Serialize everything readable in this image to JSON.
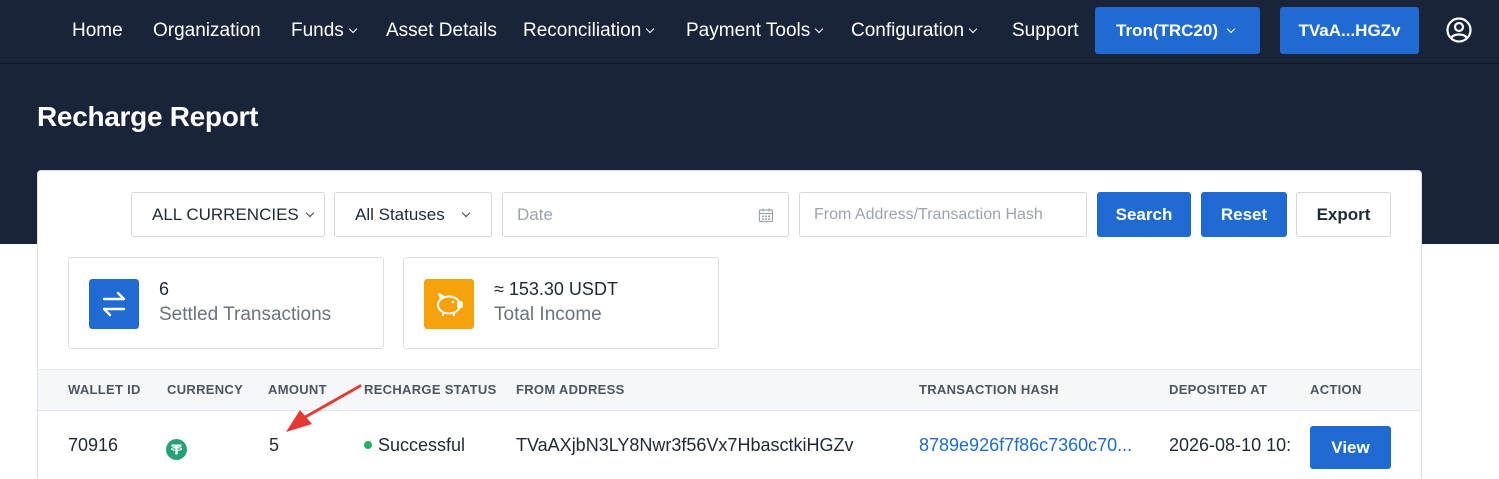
{
  "nav": {
    "items": [
      {
        "label": "Home",
        "dropdown": false
      },
      {
        "label": "Organization",
        "dropdown": false
      },
      {
        "label": "Funds",
        "dropdown": true
      },
      {
        "label": "Asset Details",
        "dropdown": false
      },
      {
        "label": "Reconciliation",
        "dropdown": true
      },
      {
        "label": "Payment Tools",
        "dropdown": true
      },
      {
        "label": "Configuration",
        "dropdown": true
      },
      {
        "label": "Support",
        "dropdown": false
      }
    ],
    "network_button": "Tron(TRC20)",
    "wallet_button": "TVaA...HGZv",
    "user_icon": "user-circle-icon"
  },
  "page": {
    "title": "Recharge Report"
  },
  "filters": {
    "currency_select": "ALL CURRENCIES",
    "status_select": "All Statuses",
    "date_placeholder": "Date",
    "search_placeholder": "From Address/Transaction Hash",
    "search_button": "Search",
    "reset_button": "Reset",
    "export_button": "Export"
  },
  "stats": [
    {
      "value": "6",
      "label": "Settled Transactions",
      "icon": "transfer-arrows-icon",
      "color": "#1f6bd1"
    },
    {
      "value": "≈ 153.30 USDT",
      "label": "Total Income",
      "icon": "piggy-bank-icon",
      "color": "#f5a20b"
    }
  ],
  "table": {
    "columns": [
      "WALLET ID",
      "CURRENCY",
      "AMOUNT",
      "RECHARGE STATUS",
      "FROM ADDRESS",
      "TRANSACTION HASH",
      "DEPOSITED AT",
      "ACTION"
    ],
    "rows": [
      {
        "wallet_id": "70916",
        "currency_icon": "tether-icon",
        "amount": "5",
        "status": "Successful",
        "from_address": "TVaAXjbN3LY8Nwr3f56Vx7HbasctkiHGZv",
        "tx_hash": "8789e926f7f86c7360c70...",
        "deposited_at": "2026-08-10 10:",
        "action": "View"
      }
    ]
  },
  "colors": {
    "header_bg": "#19243a",
    "primary": "#1f6bd1",
    "success": "#22b35e",
    "tether": "#26a17b",
    "annotation": "#e53935"
  }
}
